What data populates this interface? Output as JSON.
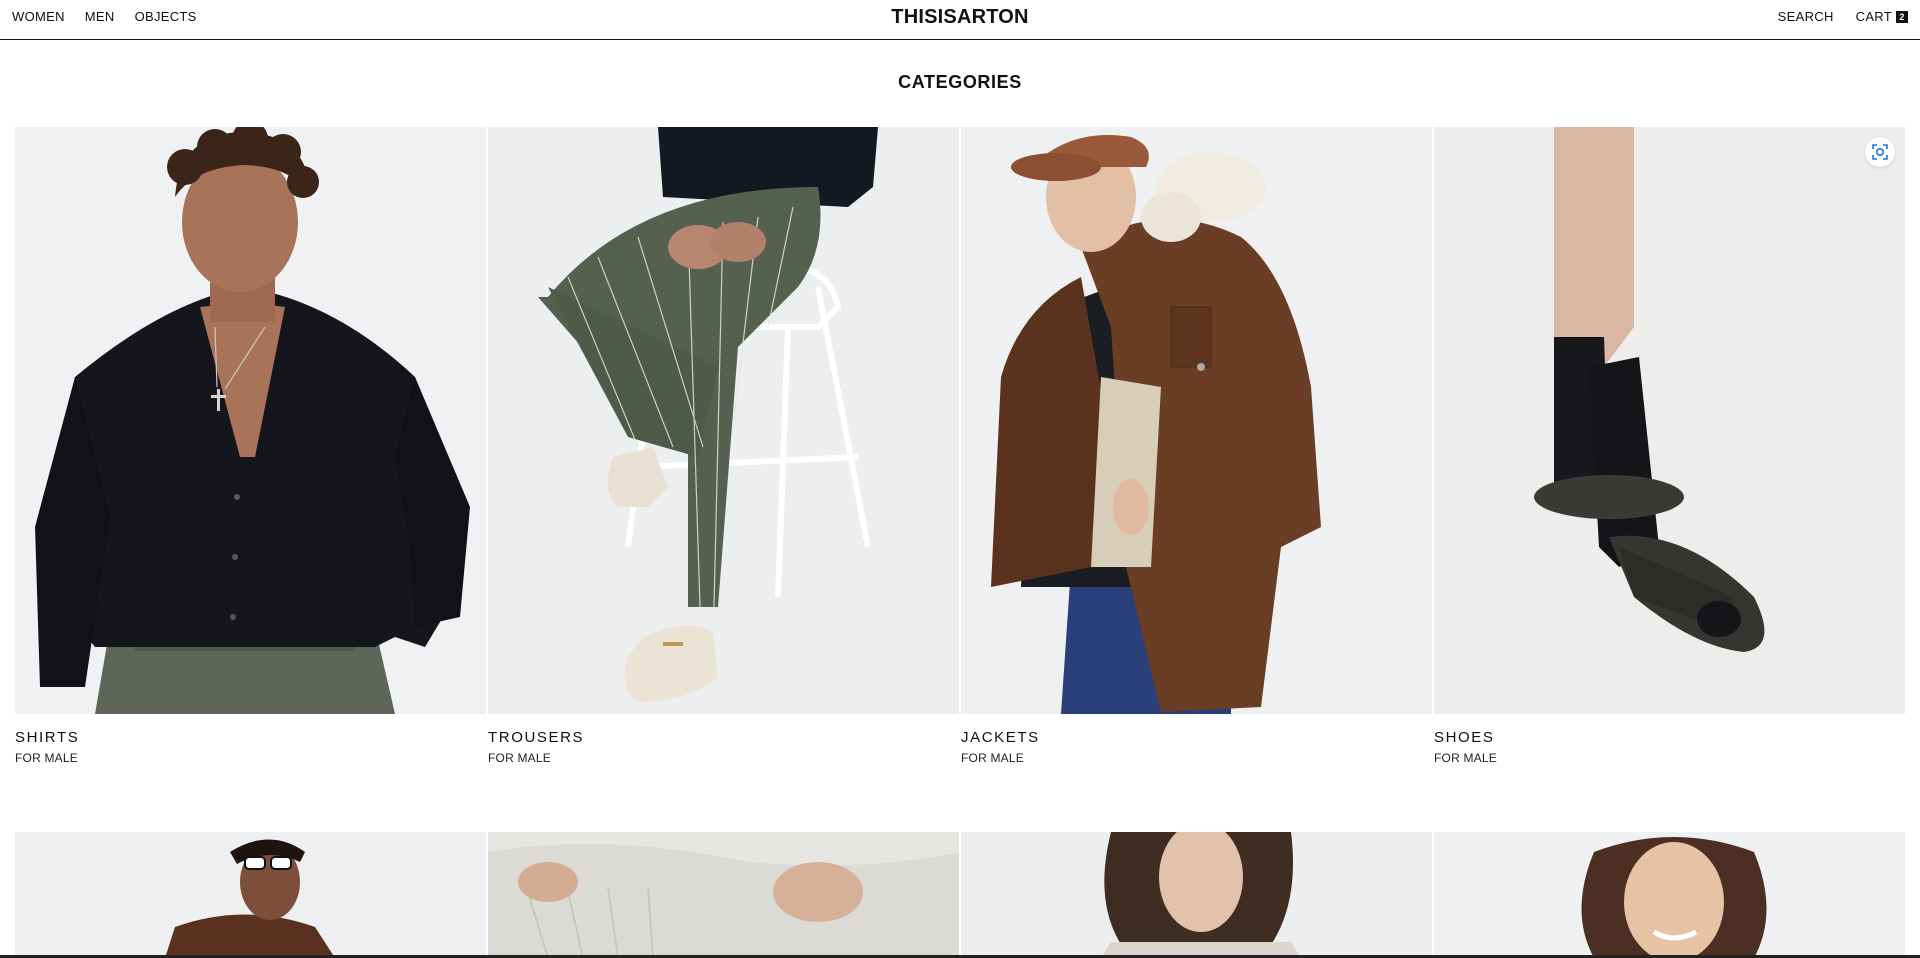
{
  "header": {
    "nav_left": [
      "WOMEN",
      "MEN",
      "OBJECTS"
    ],
    "logo": "THISISARTON",
    "search_label": "SEARCH",
    "cart_label": "CART",
    "cart_count": "2"
  },
  "section": {
    "title": "CATEGORIES"
  },
  "categories": [
    {
      "title": "SHIRTS",
      "subtitle": "FOR MALE",
      "icon": "shirt-model-photo"
    },
    {
      "title": "TROUSERS",
      "subtitle": "FOR MALE",
      "icon": "trousers-model-photo"
    },
    {
      "title": "JACKETS",
      "subtitle": "FOR MALE",
      "icon": "jacket-model-photo"
    },
    {
      "title": "SHOES",
      "subtitle": "FOR MALE",
      "icon": "shoes-photo"
    }
  ],
  "second_row": [
    {
      "icon": "woman-sunglasses-photo"
    },
    {
      "icon": "knit-sweater-photo"
    },
    {
      "icon": "woman-portrait-photo"
    },
    {
      "icon": "woman-smiling-photo"
    }
  ],
  "colors": {
    "text": "#111111",
    "photo_bg": "#eef0f1",
    "accent_scan": "#1a73e8"
  }
}
